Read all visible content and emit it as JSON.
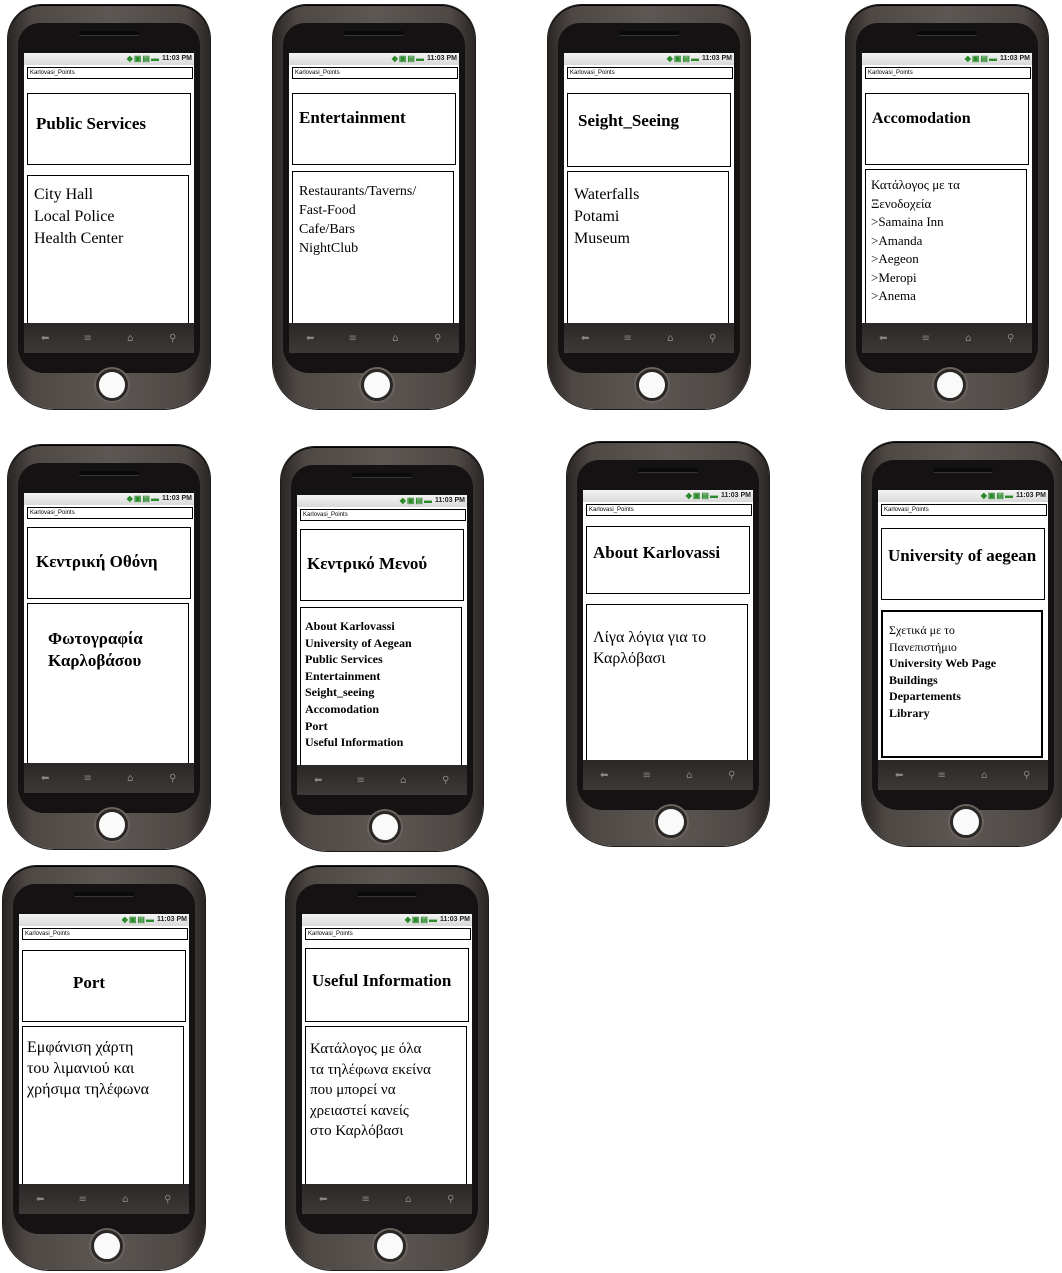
{
  "status": {
    "time": "11:03 PM"
  },
  "app_title": "Karlovasi_Points",
  "nav": {
    "back": "⬅",
    "menu": "≡",
    "home": "⌂",
    "search": "⚲"
  },
  "phones": [
    {
      "header": "Public Services",
      "lines": [
        "City Hall",
        "Local Police",
        "Health Center"
      ]
    },
    {
      "header": "Entertainment",
      "lines": [
        "Restaurants/Taverns/",
        "Fast-Food",
        "Cafe/Bars",
        "NightClub"
      ]
    },
    {
      "header": "Seight_Seeing",
      "lines": [
        "Waterfalls",
        "Potami",
        "Museum"
      ]
    },
    {
      "header": "Accomodation",
      "lines": [
        "Κατάλογος με τα",
        "Ξενοδοχεία",
        ">Samaina Inn",
        ">Amanda",
        ">Aegeon",
        ">Meropi",
        ">Anema"
      ]
    },
    {
      "header": "Κεντρική Οθόνη",
      "lines": [
        "Φωτογραφία",
        "Καρλοβάσου"
      ]
    },
    {
      "header": "Κεντρικό Μενού",
      "lines": [
        "About Karlovassi",
        "University of Aegean",
        "Public Services",
        "Entertainment",
        "Seight_seeing",
        "Accomodation",
        "Port",
        "Useful Information"
      ]
    },
    {
      "header": "About Karlovassi",
      "lines": [
        "Λίγα λόγια για το",
        "Καρλόβασι"
      ]
    },
    {
      "header": "University of aegean",
      "lines": [
        "Σχετικά με το",
        "Πανεπιστήμιο",
        "University Web Page",
        "Buildings",
        "Departements",
        "Library"
      ]
    },
    {
      "header": "Port",
      "lines": [
        "Εμφάνιση χάρτη",
        "του λιμανιού και",
        "χρήσιμα τηλέφωνα"
      ]
    },
    {
      "header": "Useful Information",
      "lines": [
        "Κατάλογος με όλα",
        "τα τηλέφωνα εκείνα",
        "που μπορεί να",
        "χρειαστεί κανείς",
        "στο Καρλόβασι"
      ]
    }
  ]
}
